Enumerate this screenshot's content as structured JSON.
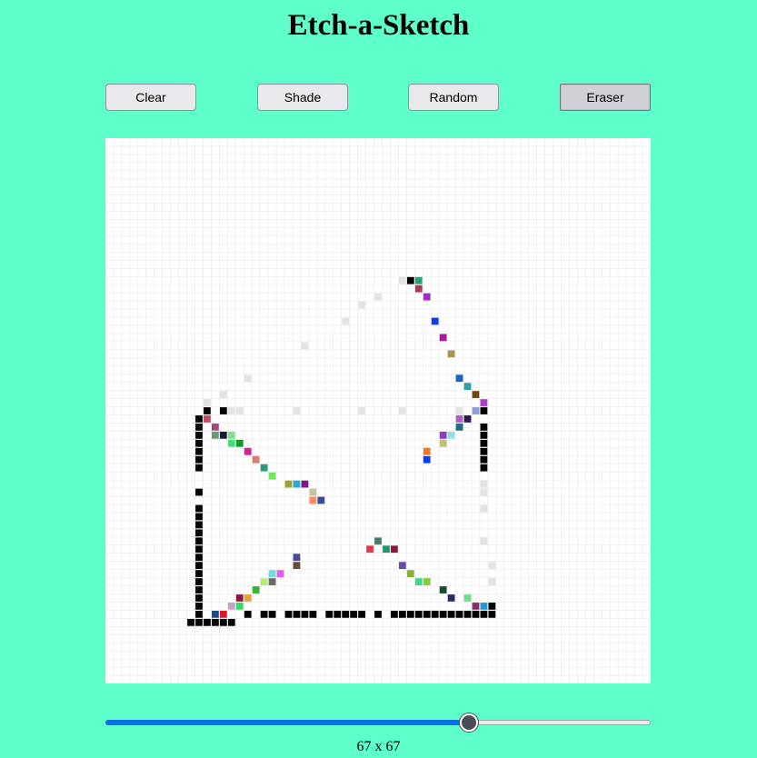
{
  "title": "Etch-a-Sketch",
  "buttons": {
    "clear": "Clear",
    "shade": "Shade",
    "random": "Random",
    "eraser": "Eraser"
  },
  "active_mode": "Eraser",
  "grid": {
    "size": 67,
    "grid_line_color": "#e8e8e8",
    "background": "#ffffff",
    "cells": [
      [
        36,
        17,
        "#e3e3e3"
      ],
      [
        37,
        17,
        "#000000"
      ],
      [
        38,
        17,
        "#1ba672"
      ],
      [
        38,
        18,
        "#a83a5e"
      ],
      [
        39,
        19,
        "#9c2fbf"
      ],
      [
        33,
        19,
        "#e3e3e3"
      ],
      [
        31,
        20,
        "#e3e3e3"
      ],
      [
        29,
        22,
        "#e3e3e3"
      ],
      [
        40,
        22,
        "#0a3ee8"
      ],
      [
        41,
        24,
        "#a01c98"
      ],
      [
        24,
        25,
        "#e3e3e3"
      ],
      [
        42,
        26,
        "#a8954f"
      ],
      [
        17,
        29,
        "#e3e3e3"
      ],
      [
        43,
        29,
        "#1e62c9"
      ],
      [
        44,
        30,
        "#2aa2a5"
      ],
      [
        14,
        31,
        "#e3e3e3"
      ],
      [
        45,
        31,
        "#6b4b12"
      ],
      [
        12,
        32,
        "#e3e3e3"
      ],
      [
        46,
        32,
        "#b23ad1"
      ],
      [
        12,
        33,
        "#000000"
      ],
      [
        14,
        33,
        "#000000"
      ],
      [
        15,
        33,
        "#e3e3e3"
      ],
      [
        16,
        33,
        "#e3e3e3"
      ],
      [
        23,
        33,
        "#e3e3e3"
      ],
      [
        31,
        33,
        "#e3e3e3"
      ],
      [
        36,
        33,
        "#e3e3e3"
      ],
      [
        43,
        33,
        "#e3e3e3"
      ],
      [
        45,
        33,
        "#8c9fcf"
      ],
      [
        46,
        33,
        "#000000"
      ],
      [
        11,
        34,
        "#000000"
      ],
      [
        12,
        34,
        "#c2485e"
      ],
      [
        43,
        34,
        "#b05cc0"
      ],
      [
        44,
        34,
        "#2a1a4a"
      ],
      [
        11,
        35,
        "#000000"
      ],
      [
        13,
        35,
        "#a4497c"
      ],
      [
        43,
        35,
        "#1f6f7a"
      ],
      [
        46,
        35,
        "#000000"
      ],
      [
        11,
        36,
        "#000000"
      ],
      [
        13,
        36,
        "#6d9a75"
      ],
      [
        14,
        36,
        "#1a1a3a"
      ],
      [
        15,
        36,
        "#7fe08a"
      ],
      [
        41,
        36,
        "#8a3fb8"
      ],
      [
        42,
        36,
        "#8de0ea"
      ],
      [
        46,
        36,
        "#000000"
      ],
      [
        11,
        37,
        "#000000"
      ],
      [
        15,
        37,
        "#3fe07a"
      ],
      [
        16,
        37,
        "#149a2a"
      ],
      [
        41,
        37,
        "#c4bb7c"
      ],
      [
        46,
        37,
        "#000000"
      ],
      [
        11,
        38,
        "#000000"
      ],
      [
        17,
        38,
        "#d61f9a"
      ],
      [
        39,
        38,
        "#f07a20"
      ],
      [
        46,
        38,
        "#000000"
      ],
      [
        11,
        39,
        "#000000"
      ],
      [
        18,
        39,
        "#d4806a"
      ],
      [
        39,
        39,
        "#0a3ee8"
      ],
      [
        46,
        39,
        "#000000"
      ],
      [
        11,
        40,
        "#000000"
      ],
      [
        19,
        40,
        "#2a9a7f"
      ],
      [
        46,
        40,
        "#000000"
      ],
      [
        20,
        41,
        "#74e85a"
      ],
      [
        22,
        42,
        "#a0a030"
      ],
      [
        23,
        42,
        "#2ca8d8"
      ],
      [
        24,
        42,
        "#7a1a8a"
      ],
      [
        46,
        42,
        "#e3e3e3"
      ],
      [
        11,
        43,
        "#000000"
      ],
      [
        25,
        43,
        "#c4c4a0"
      ],
      [
        46,
        43,
        "#e3e3e3"
      ],
      [
        25,
        44,
        "#ff8a5a"
      ],
      [
        26,
        44,
        "#3a4a9a"
      ],
      [
        11,
        45,
        "#000000"
      ],
      [
        46,
        45,
        "#e3e3e3"
      ],
      [
        11,
        46,
        "#000000"
      ],
      [
        11,
        47,
        "#000000"
      ],
      [
        11,
        48,
        "#000000"
      ],
      [
        11,
        49,
        "#000000"
      ],
      [
        33,
        49,
        "#4a7a6a"
      ],
      [
        46,
        49,
        "#e3e3e3"
      ],
      [
        11,
        50,
        "#000000"
      ],
      [
        32,
        50,
        "#e03a4a"
      ],
      [
        34,
        50,
        "#1a9a6a"
      ],
      [
        35,
        50,
        "#8a1a3a"
      ],
      [
        11,
        51,
        "#000000"
      ],
      [
        23,
        51,
        "#4a4aa0"
      ],
      [
        11,
        52,
        "#000000"
      ],
      [
        23,
        52,
        "#6a4a3a"
      ],
      [
        36,
        52,
        "#6a4ab0"
      ],
      [
        47,
        52,
        "#e3e3e3"
      ],
      [
        11,
        53,
        "#000000"
      ],
      [
        20,
        53,
        "#7ad8d8"
      ],
      [
        21,
        53,
        "#e85ae8"
      ],
      [
        37,
        53,
        "#8ab03a"
      ],
      [
        11,
        54,
        "#000000"
      ],
      [
        19,
        54,
        "#b0f070"
      ],
      [
        20,
        54,
        "#6a6a6a"
      ],
      [
        38,
        54,
        "#3ad88a"
      ],
      [
        39,
        54,
        "#8ac83a"
      ],
      [
        47,
        54,
        "#e3e3e3"
      ],
      [
        11,
        55,
        "#000000"
      ],
      [
        18,
        55,
        "#3ab03a"
      ],
      [
        41,
        55,
        "#1a4a2a"
      ],
      [
        11,
        56,
        "#000000"
      ],
      [
        16,
        56,
        "#8a1a3a"
      ],
      [
        17,
        56,
        "#f0a030"
      ],
      [
        42,
        56,
        "#2a2a6a"
      ],
      [
        44,
        56,
        "#6ae08a"
      ],
      [
        11,
        57,
        "#000000"
      ],
      [
        15,
        57,
        "#c8a0c8"
      ],
      [
        16,
        57,
        "#3ad86a"
      ],
      [
        45,
        57,
        "#8a2a6a"
      ],
      [
        46,
        57,
        "#1a9ad8"
      ],
      [
        47,
        57,
        "#000000"
      ],
      [
        11,
        58,
        "#000000"
      ],
      [
        13,
        58,
        "#1a4a8a"
      ],
      [
        14,
        58,
        "#d01a2a"
      ],
      [
        17,
        58,
        "#000000"
      ],
      [
        19,
        58,
        "#000000"
      ],
      [
        20,
        58,
        "#000000"
      ],
      [
        22,
        58,
        "#000000"
      ],
      [
        23,
        58,
        "#000000"
      ],
      [
        24,
        58,
        "#000000"
      ],
      [
        25,
        58,
        "#000000"
      ],
      [
        27,
        58,
        "#000000"
      ],
      [
        28,
        58,
        "#000000"
      ],
      [
        29,
        58,
        "#000000"
      ],
      [
        30,
        58,
        "#000000"
      ],
      [
        31,
        58,
        "#000000"
      ],
      [
        33,
        58,
        "#000000"
      ],
      [
        35,
        58,
        "#000000"
      ],
      [
        36,
        58,
        "#000000"
      ],
      [
        37,
        58,
        "#000000"
      ],
      [
        38,
        58,
        "#000000"
      ],
      [
        39,
        58,
        "#000000"
      ],
      [
        40,
        58,
        "#000000"
      ],
      [
        41,
        58,
        "#000000"
      ],
      [
        42,
        58,
        "#000000"
      ],
      [
        43,
        58,
        "#000000"
      ],
      [
        44,
        58,
        "#000000"
      ],
      [
        45,
        58,
        "#000000"
      ],
      [
        46,
        58,
        "#000000"
      ],
      [
        47,
        58,
        "#000000"
      ],
      [
        10,
        59,
        "#000000"
      ],
      [
        11,
        59,
        "#000000"
      ],
      [
        12,
        59,
        "#000000"
      ],
      [
        13,
        59,
        "#000000"
      ],
      [
        14,
        59,
        "#000000"
      ],
      [
        15,
        59,
        "#000000"
      ]
    ]
  },
  "slider": {
    "min": 1,
    "max": 100,
    "value": 67,
    "fill_color": "#0b6ee3",
    "label": "67 x 67"
  }
}
